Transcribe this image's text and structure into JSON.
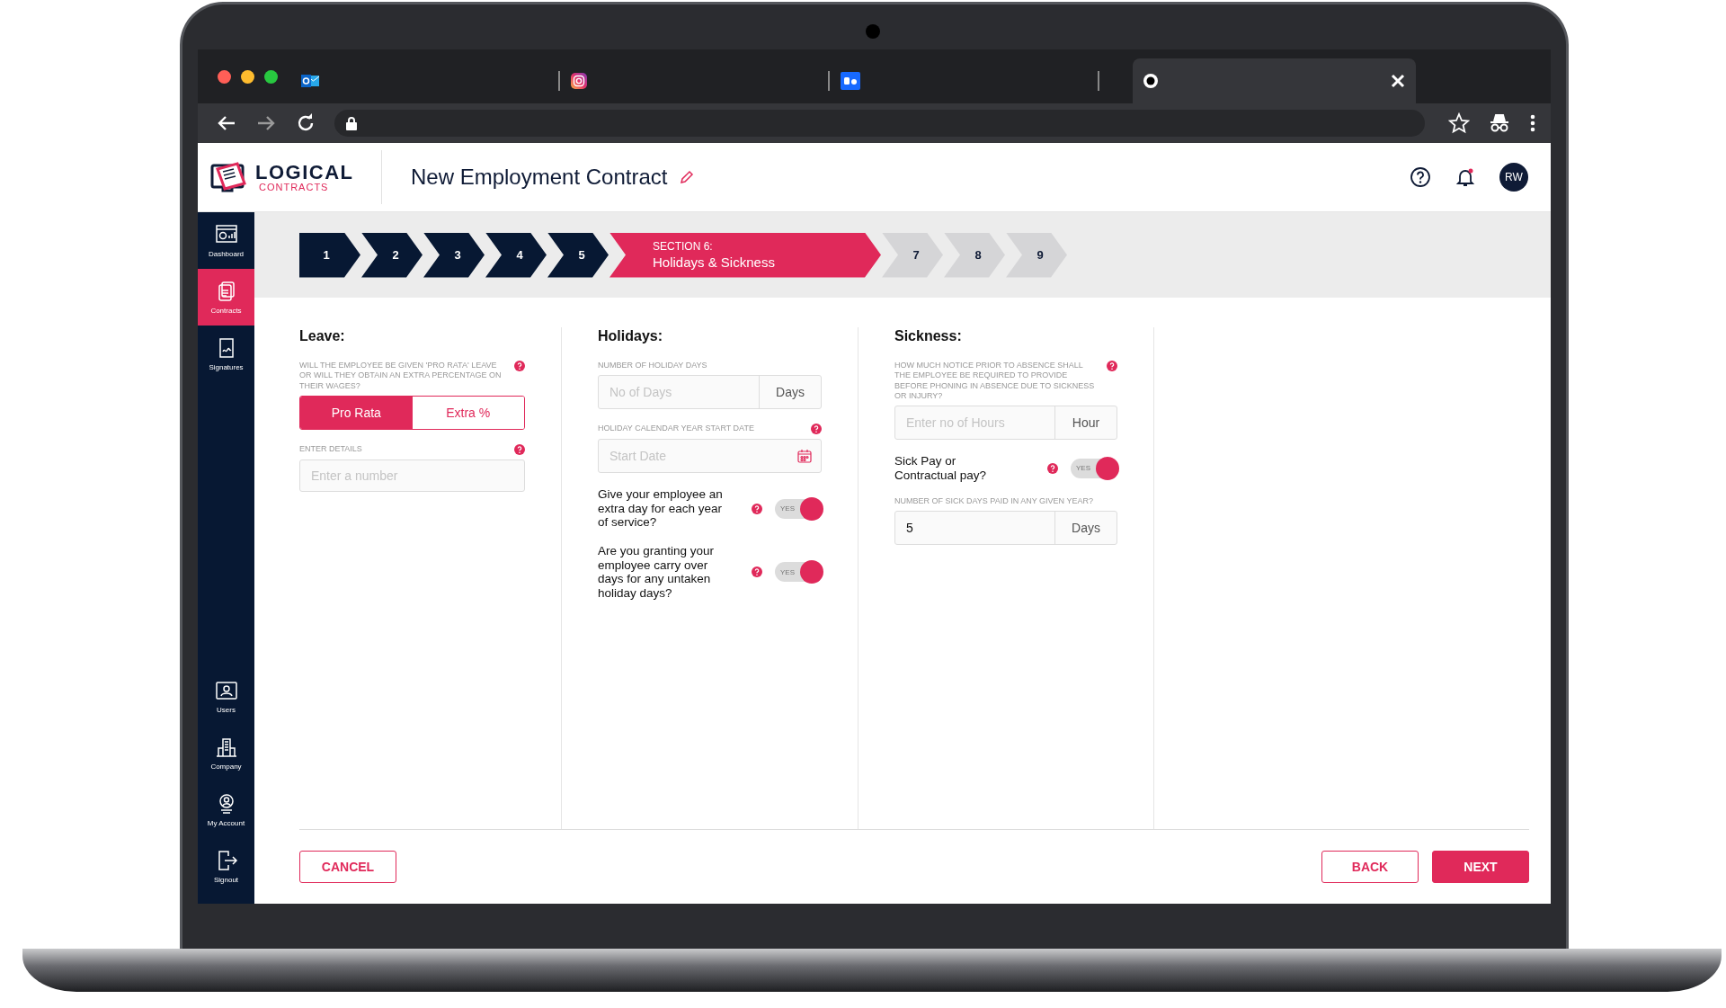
{
  "browser": {
    "tabs": [
      {
        "kind": "mail",
        "selected": false
      },
      {
        "kind": "camera",
        "selected": false
      },
      {
        "kind": "behance",
        "selected": false
      },
      {
        "kind": "site",
        "selected": true
      }
    ]
  },
  "app": {
    "logo": {
      "title": "LOGICAL",
      "subtitle": "CONTRACTS"
    },
    "page_title": "New Employment Contract",
    "avatar": "RW"
  },
  "sidebar": {
    "items": [
      {
        "kind": "dashboard",
        "label": "Dashboard",
        "selected": false
      },
      {
        "kind": "contracts",
        "label": "Contracts",
        "selected": true
      },
      {
        "kind": "signatures",
        "label": "Signatures",
        "selected": false
      }
    ],
    "bottom_items": [
      {
        "kind": "users",
        "label": "Users",
        "selected": false
      },
      {
        "kind": "company",
        "label": "Company",
        "selected": false
      },
      {
        "kind": "account",
        "label": "My Account",
        "selected": false
      },
      {
        "kind": "signout",
        "label": "Signout",
        "selected": false
      }
    ]
  },
  "stepper": [
    {
      "done": true,
      "selected": false,
      "number": "1"
    },
    {
      "done": true,
      "selected": false,
      "number": "2"
    },
    {
      "done": true,
      "selected": false,
      "number": "3"
    },
    {
      "done": true,
      "selected": false,
      "number": "4"
    },
    {
      "done": true,
      "selected": false,
      "number": "5"
    },
    {
      "selected": true,
      "section": "SECTION 6:",
      "title": "Holidays & Sickness"
    },
    {
      "done": false,
      "selected": false,
      "number": "7"
    },
    {
      "done": false,
      "selected": false,
      "number": "8"
    },
    {
      "done": false,
      "selected": false,
      "number": "9"
    }
  ],
  "columns": [
    {
      "heading": "Leave:",
      "fields": [
        {
          "kind": "segmented",
          "label": "WILL THE EMPLOYEE BE GIVEN 'PRO RATA' LEAVE OR WILL THEY OBTAIN AN EXTRA PERCENTAGE ON THEIR WAGES?",
          "help": true,
          "options": [
            {
              "label": "Pro Rata",
              "selected": true
            },
            {
              "label": "Extra %",
              "selected": false
            }
          ]
        },
        {
          "kind": "input",
          "label": "ENTER DETAILS",
          "help": true,
          "placeholder": "Enter a number"
        }
      ]
    },
    {
      "heading": "Holidays:",
      "fields": [
        {
          "kind": "unit_input",
          "label": "NUMBER OF HOLIDAY DAYS",
          "help": false,
          "placeholder": "No of Days",
          "unit": "Days"
        },
        {
          "kind": "date",
          "label": "HOLIDAY CALENDAR YEAR START DATE",
          "help": true,
          "placeholder": "Start Date"
        },
        {
          "kind": "toggle",
          "text": "Give your employee an extra day for each year of service?",
          "help": true,
          "on": true,
          "on_label": "YES"
        },
        {
          "kind": "toggle",
          "text": "Are you granting your employee carry over days for any untaken holiday days?",
          "help": true,
          "on": true,
          "on_label": "YES"
        }
      ]
    },
    {
      "heading": "Sickness:",
      "fields": [
        {
          "kind": "unit_input",
          "label": "HOW MUCH NOTICE PRIOR TO ABSENCE SHALL THE EMPLOYEE BE REQUIRED TO PROVIDE BEFORE PHONING IN ABSENCE DUE TO SICKNESS OR INJURY?",
          "help": true,
          "placeholder": "Enter no of Hours",
          "unit": "Hour"
        },
        {
          "kind": "toggle",
          "text": "Sick Pay or Contractual pay?",
          "help": true,
          "on": true,
          "on_label": "YES"
        },
        {
          "kind": "unit_input",
          "label": "NUMBER OF SICK DAYS PAID IN ANY GIVEN YEAR?",
          "help": false,
          "value": "5",
          "unit": "Days"
        }
      ]
    }
  ],
  "footer": {
    "left": [
      {
        "label": "CANCEL",
        "kind": "outline"
      }
    ],
    "right": [
      {
        "label": "BACK",
        "kind": "outline"
      },
      {
        "label": "NEXT",
        "kind": "primary"
      }
    ]
  }
}
